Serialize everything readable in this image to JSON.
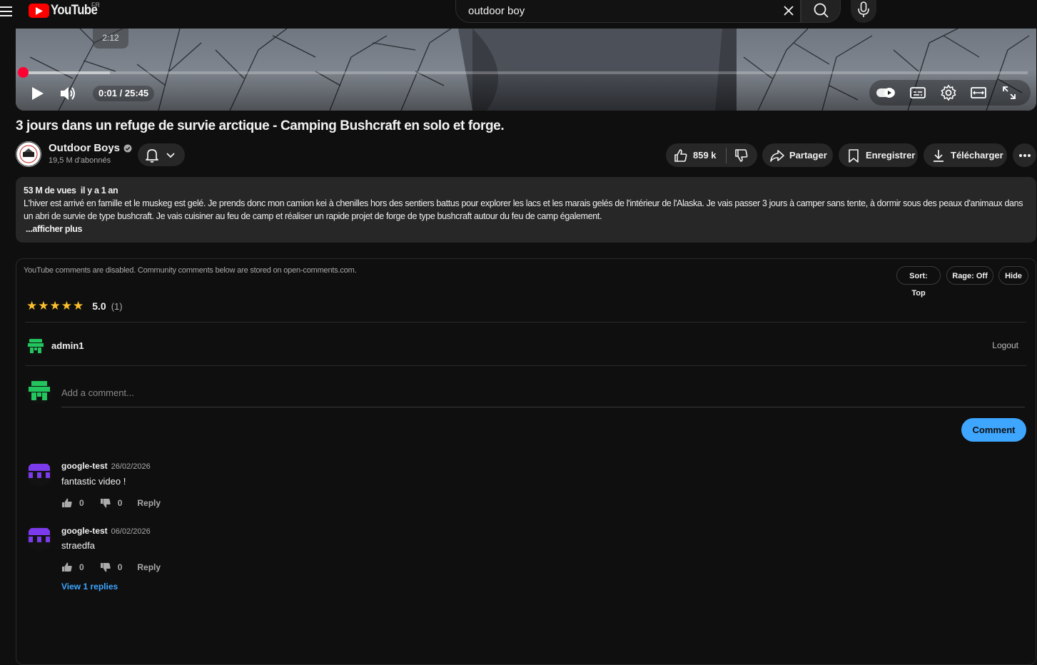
{
  "header": {
    "logo_text": "YouTube",
    "country_code": "FR",
    "search_value": "outdoor boy"
  },
  "player": {
    "seek_preview_time": "2:12",
    "time_display": "0:01 / 25:45",
    "progress_fraction": 0.0006,
    "buffered_fraction": 0.085
  },
  "video": {
    "title": "3 jours dans un refuge de survie arctique - Camping Bushcraft en solo et forge.",
    "channel_name": "Outdoor Boys",
    "subscribers": "19,5 M d'abonnés",
    "likes": "859 k",
    "share_label": "Partager",
    "save_label": "Enregistrer",
    "download_label": "Télécharger"
  },
  "description": {
    "views": "53 M de vues",
    "age": "il y a 1 an",
    "text": "L'hiver est arrivé en famille et le muskeg est gelé. Je prends donc mon camion kei à chenilles hors des sentiers battus pour explorer les lacs et les marais gelés de l'intérieur de l'Alaska. Je vais passer 3 jours à camper sans tente, à dormir sous des peaux d'animaux dans un abri de survie de type bushcraft. Je vais cuisiner au feu de camp et réaliser un rapide projet de forge de type bushcraft autour du feu de camp également.",
    "more_label": "...afficher plus"
  },
  "comments_panel": {
    "notice": "YouTube comments are disabled. Community comments below are stored on open-comments.com.",
    "sort_label": "Sort: Top",
    "rage_label": "Rage: Off",
    "hide_label": "Hide",
    "rating_score": "5.0",
    "rating_count": "(1)",
    "stars": 5,
    "current_user": "admin1",
    "logout_label": "Logout",
    "compose_placeholder": "Add a comment...",
    "comment_button": "Comment",
    "view_replies_label": "View 1 replies",
    "colors": {
      "accent": "#3ea6ff",
      "star": "#fbc02d",
      "user_avatar": "#22c55e",
      "commenter_avatar": "#7c3aed"
    },
    "comments": [
      {
        "author": "google-test",
        "date": "26/02/2026",
        "text": "fantastic video !",
        "likes": "0",
        "dislikes": "0",
        "reply_label": "Reply"
      },
      {
        "author": "google-test",
        "date": "06/02/2026",
        "text": "straedfa",
        "likes": "0",
        "dislikes": "0",
        "reply_label": "Reply"
      }
    ]
  }
}
